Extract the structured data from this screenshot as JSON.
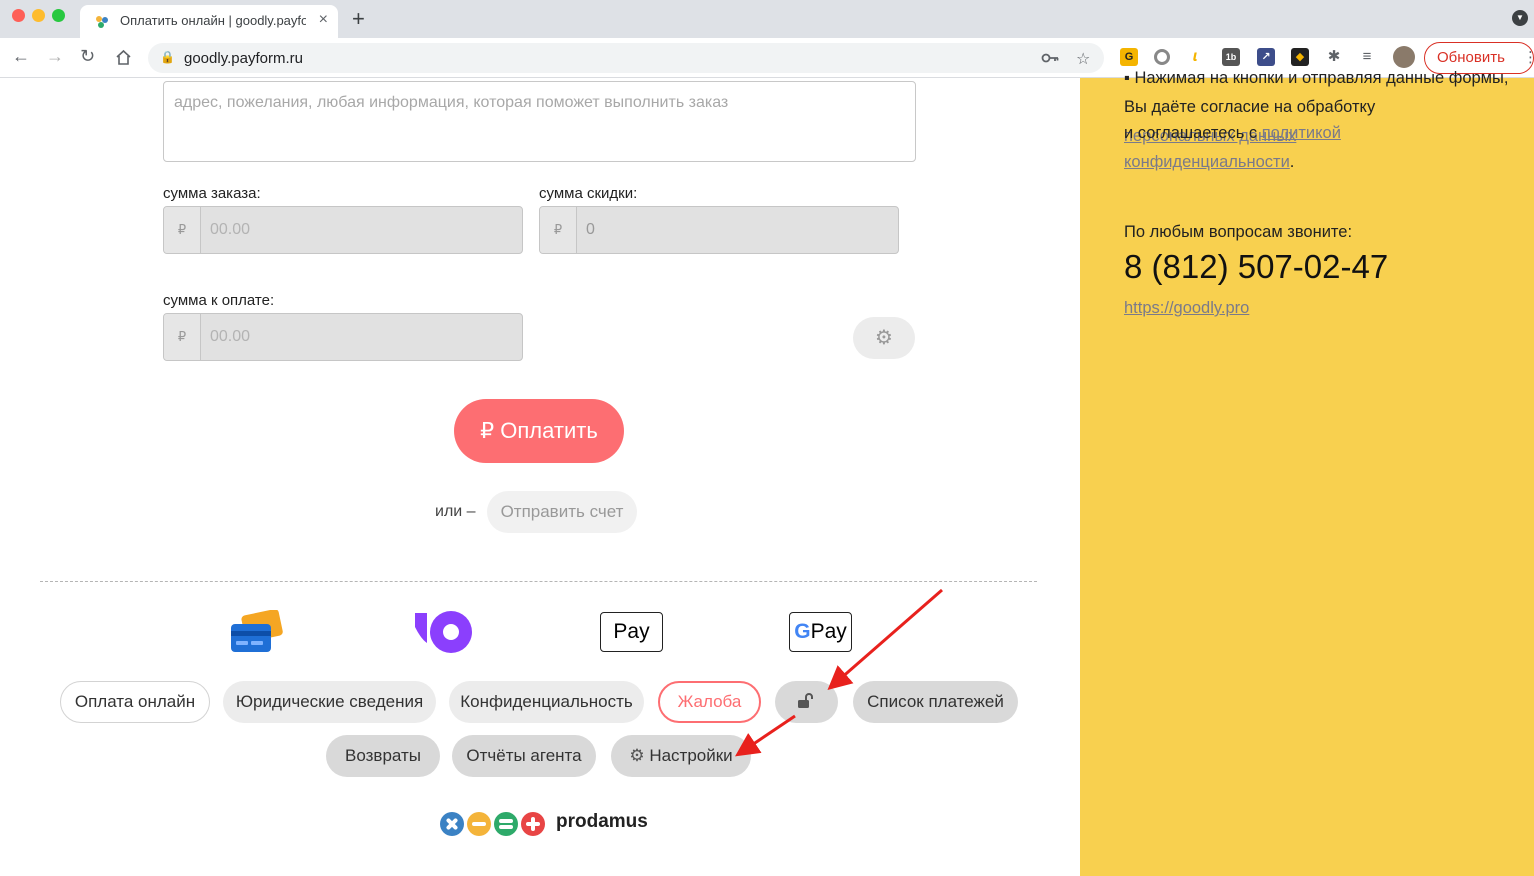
{
  "browser": {
    "tab_title": "Оплатить онлайн | goodly.payform.ru",
    "tab_close": "×",
    "new_tab": "+",
    "url": "goodly.payform.ru",
    "update_label": "Обновить"
  },
  "form": {
    "comment_placeholder": "адрес, пожелания, любая информация, которая поможет выполнить заказ",
    "order_sum_label": "сумма заказа:",
    "order_sum_placeholder": "00.00",
    "discount_label": "сумма скидки:",
    "discount_value": "0",
    "to_pay_label": "сумма к оплате:",
    "to_pay_placeholder": "00.00",
    "currency": "₽",
    "pay_button": "₽ Оплатить",
    "or_text": "или –",
    "send_bill": "Отправить счет"
  },
  "payment_methods": {
    "apple_pay": "Pay",
    "google_pay": "Pay"
  },
  "footer_links": {
    "online_payment": "Оплата онлайн",
    "legal_info": "Юридические сведения",
    "privacy": "Конфиденциальность",
    "complaint": "Жалоба",
    "payment_list": "Список платежей",
    "refunds": "Возвраты",
    "agent_reports": "Отчёты агента",
    "settings": "Настройки"
  },
  "brand": {
    "name": "prodamus",
    "colors": [
      "#3b82c4",
      "#f4b43a",
      "#2eaa6a",
      "#e84545"
    ]
  },
  "sidebar": {
    "consent_line1": "Нажимая на кнопки и отправляя данные формы,",
    "consent_line2": "Вы даёте согласие на обработку",
    "personal_data_link": "персональных данных",
    "consent_line3": "и соглашаетесь с",
    "privacy_policy_link": "политикой конфиденциальности",
    "consent_end": ".",
    "questions_label": "По любым вопросам звоните:",
    "phone": "8 (812) 507-02-47",
    "site_link": "https://goodly.pro"
  },
  "colors": {
    "accent": "#fd6e72",
    "sidebar_bg": "#f8d04f",
    "annotation_arrow": "#e8211d"
  }
}
